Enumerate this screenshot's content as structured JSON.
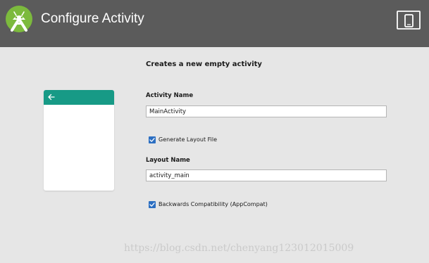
{
  "header": {
    "title": "Configure Activity",
    "logo_icon": "android-studio-logo-icon",
    "device_icon": "tablet-phone-icon",
    "background_color": "#5b5b5b"
  },
  "preview": {
    "appbar_color": "#179a86",
    "back_icon": "back-arrow-icon"
  },
  "form": {
    "subtitle": "Creates a new empty activity",
    "activity_name_label": "Activity Name",
    "activity_name_value": "MainActivity",
    "generate_layout_label": "Generate Layout File",
    "generate_layout_checked": true,
    "layout_name_label": "Layout Name",
    "layout_name_value": "activity_main",
    "backwards_compat_label": "Backwards Compatibility (AppCompat)",
    "backwards_compat_checked": true,
    "accent_color": "#2c6fc2"
  },
  "watermark": "https://blog.csdn.net/chenyang123012015009"
}
